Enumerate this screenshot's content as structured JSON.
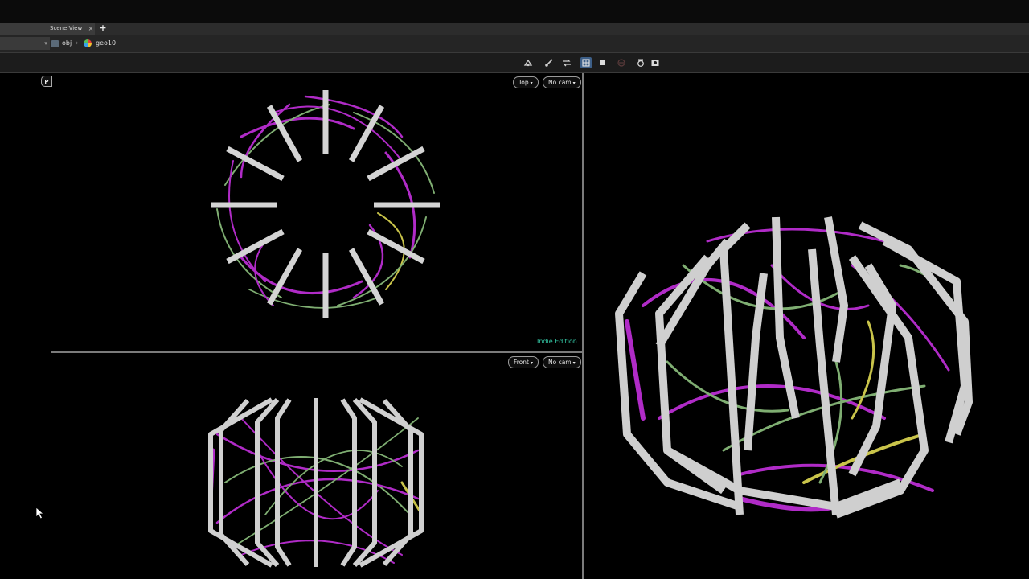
{
  "tabs": [
    {
      "label": "Scene View",
      "close": "×"
    },
    {
      "label": "+"
    }
  ],
  "path": {
    "dropdown_arrow": "▾",
    "items": [
      {
        "label": "obj",
        "icon": "object-network-icon"
      },
      {
        "label": "geo10",
        "icon": "geometry-node-icon"
      }
    ]
  },
  "toolbar_icons": [
    "display-options-icon",
    "snap-icon",
    "link-icon",
    "wireframe-shading-icon",
    "ghost-icon",
    "disabled-icon",
    "camera-icon",
    "screenshot-icon"
  ],
  "pane_badge": "P",
  "viewports": {
    "top": {
      "view": "Top",
      "camera": "No cam",
      "watermark": "Indie Edition"
    },
    "front": {
      "view": "Front",
      "camera": "No cam"
    },
    "perspective": {}
  },
  "colors": {
    "magenta": "#b02bc7",
    "green": "#7fae72",
    "yellow": "#c9c44a",
    "frame": "#d2d2d2",
    "watermark": "#35c9a7"
  }
}
